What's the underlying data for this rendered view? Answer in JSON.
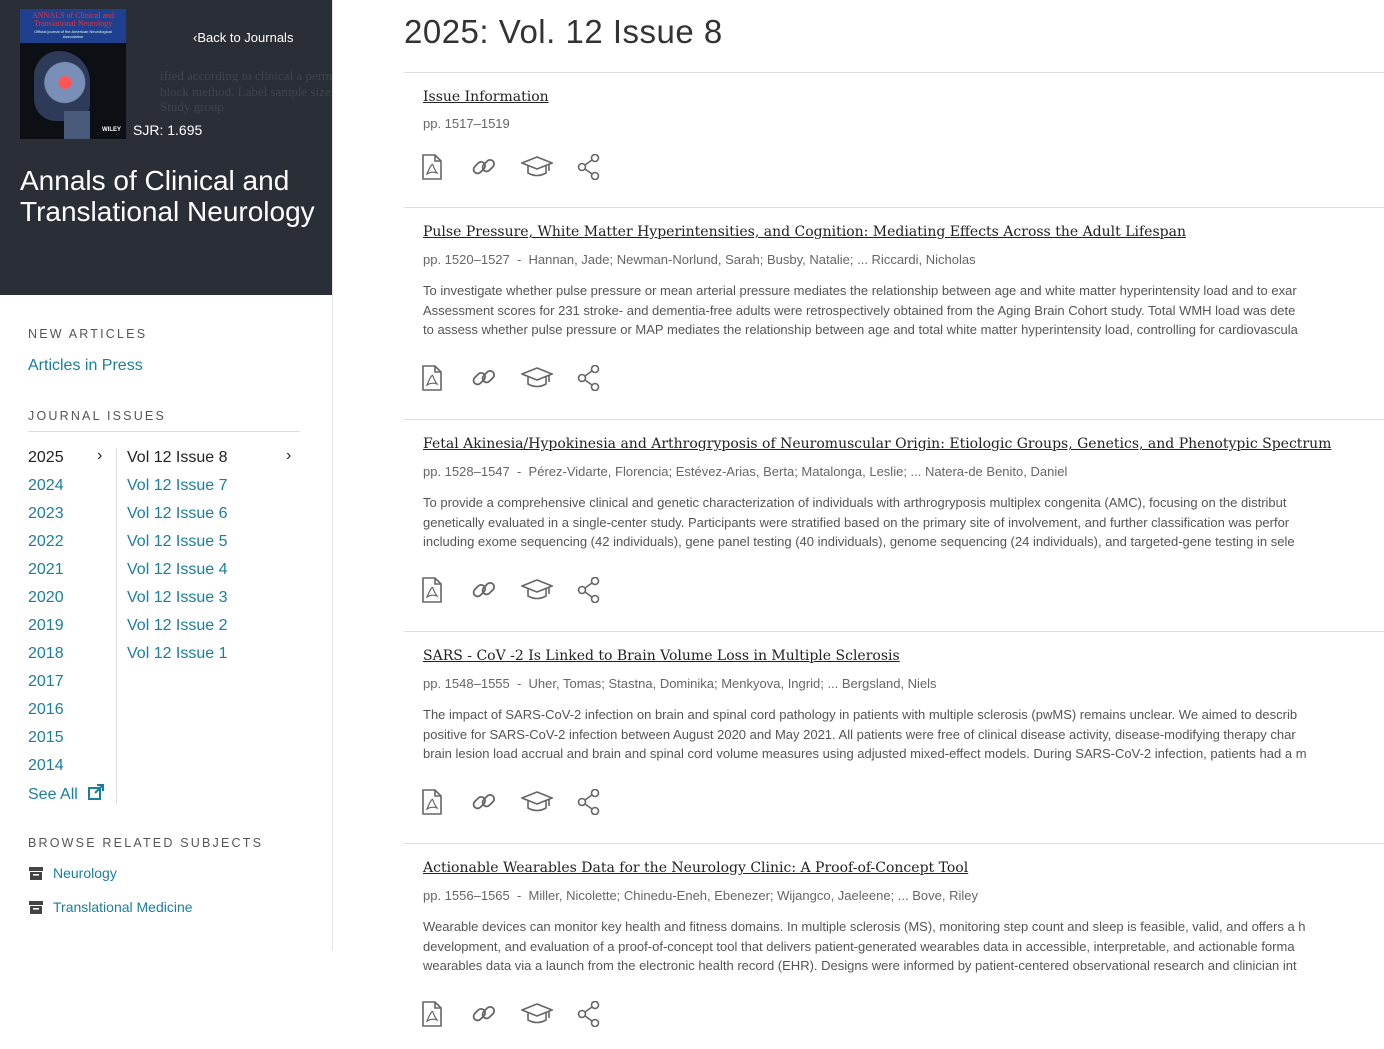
{
  "sidebar": {
    "back_label": "Back to Journals",
    "sjr": "SJR: 1.695",
    "journal_title": "Annals of Clinical and Translational Neurology",
    "cover": {
      "title": "ANNALS of Clinical and Translational Neurology",
      "subtitle": "Official journal of the American Neurological Association",
      "publisher": "WILEY"
    },
    "new_articles_heading": "NEW ARTICLES",
    "articles_in_press": "Articles in Press",
    "journal_issues_heading": "JOURNAL ISSUES",
    "years": [
      "2025",
      "2024",
      "2023",
      "2022",
      "2021",
      "2020",
      "2019",
      "2018",
      "2017",
      "2016",
      "2015",
      "2014"
    ],
    "active_year": "2025",
    "see_all": "See All",
    "volumes": [
      "Vol 12 Issue 8",
      "Vol 12 Issue 7",
      "Vol 12 Issue 6",
      "Vol 12 Issue 5",
      "Vol 12 Issue 4",
      "Vol 12 Issue 3",
      "Vol 12 Issue 2",
      "Vol 12 Issue 1"
    ],
    "active_volume": "Vol 12 Issue 8",
    "browse_heading": "BROWSE RELATED SUBJECTS",
    "subjects": [
      "Neurology",
      "Translational Medicine"
    ]
  },
  "main": {
    "page_title": "2025: Vol. 12 Issue 8",
    "articles": [
      {
        "title": "Issue Information",
        "pages": "pp. 1517–1519",
        "authors": "",
        "abstract": []
      },
      {
        "title": "Pulse Pressure, White Matter Hyperintensities, and Cognition: Mediating Effects Across the Adult Lifespan",
        "pages": "pp. 1520–1527",
        "authors": "Hannan, Jade; Newman-Norlund, Sarah; Busby, Natalie; ... Riccardi, Nicholas",
        "abstract": [
          "To investigate whether pulse pressure or mean arterial pressure mediates the relationship between age and white matter hyperintensity load and to exar",
          "Assessment scores for 231 stroke- and dementia-free adults were retrospectively obtained from the Aging Brain Cohort study. Total WMH load was dete",
          "to assess whether pulse pressure or MAP mediates the relationship between age and total white matter hyperintensity load, controlling for cardiovascula"
        ]
      },
      {
        "title": "Fetal Akinesia/Hypokinesia and Arthrogryposis of Neuromuscular Origin: Etiologic Groups, Genetics, and Phenotypic Spectrum",
        "pages": "pp. 1528–1547",
        "authors": "Pérez-Vidarte, Florencia; Estévez-Arias, Berta; Matalonga, Leslie; ... Natera-de Benito, Daniel",
        "abstract": [
          "To provide a comprehensive clinical and genetic characterization of individuals with arthrogryposis multiplex congenita (AMC), focusing on the distribut",
          "genetically evaluated in a single-center study. Participants were stratified based on the primary site of involvement, and further classification was perfor",
          "including exome sequencing (42 individuals), gene panel testing (40 individuals), genome sequencing (24 individuals), and targeted-gene testing in sele"
        ]
      },
      {
        "title": "SARS - CoV -2 Is Linked to Brain Volume Loss in Multiple Sclerosis",
        "pages": "pp. 1548–1555",
        "authors": "Uher, Tomas; Stastna, Dominika; Menkyova, Ingrid; ... Bergsland, Niels",
        "abstract": [
          "The impact of SARS-CoV-2 infection on brain and spinal cord pathology in patients with multiple sclerosis (pwMS) remains unclear. We aimed to describ",
          "positive for SARS-CoV-2 infection between August 2020 and May 2021. All patients were free of clinical disease activity, disease-modifying therapy char",
          "brain lesion load accrual and brain and spinal cord volume measures using adjusted mixed-effect models. During SARS-CoV-2 infection, patients had a m"
        ]
      },
      {
        "title": "Actionable Wearables Data for the Neurology Clinic: A Proof-of-Concept Tool",
        "pages": "pp. 1556–1565",
        "authors": "Miller, Nicolette; Chinedu-Eneh, Ebenezer; Wijangco, Jaeleene; ... Bove, Riley",
        "abstract": [
          "Wearable devices can monitor key health and fitness domains. In multiple sclerosis (MS), monitoring step count and sleep is feasible, valid, and offers a h",
          "development, and evaluation of a proof-of-concept tool that delivers patient-generated wearables data in accessible, interpretable, and actionable forma",
          "wearables data via a launch from the electronic health record (EHR). Designs were informed by patient-centered observational research and clinician int"
        ]
      }
    ],
    "action_icons": [
      "pdf-icon",
      "link-icon",
      "graduation-cap-icon",
      "share-icon"
    ]
  },
  "colors": {
    "link": "#1a7f9c",
    "hero_bg": "#2a2e36",
    "icon": "#666666"
  }
}
